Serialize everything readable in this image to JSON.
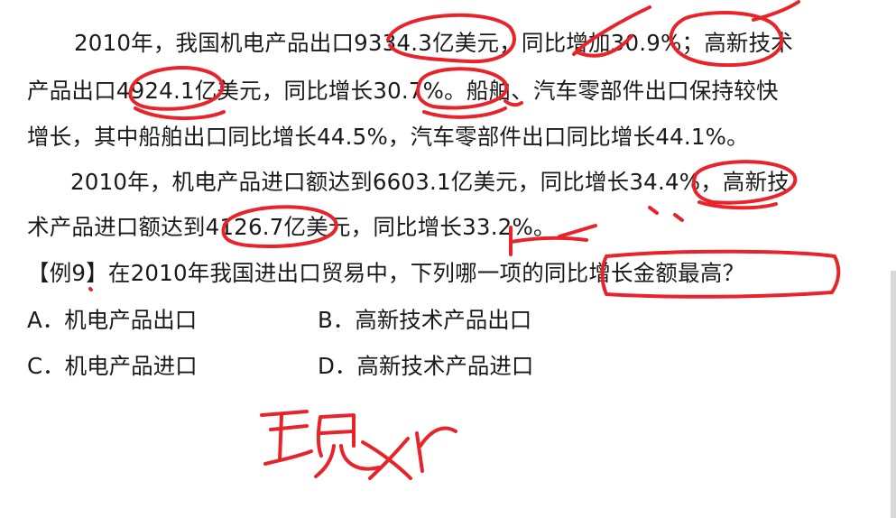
{
  "passage": {
    "line1": "2010年，我国机电产品出口9334.3亿美元，同比增加30.9%；高新技术",
    "line2": "产品出口4924.1亿美元，同比增长30.7%。船舶、汽车零部件出口保持较快",
    "line3": "增长，其中船舶出口同比增长44.5%，汽车零部件出口同比增长44.1%。",
    "line4": "2010年，机电产品进口额达到6603.1亿美元，同比增长34.4%，高新技",
    "line5": "术产品进口额达到4126.7亿美元，同比增长33.2%。"
  },
  "question": {
    "stem": "【例9】在2010年我国进出口贸易中，下列哪一项的同比增长金额最高？",
    "options": [
      {
        "letter": "A",
        "text": "A．机电产品出口"
      },
      {
        "letter": "B",
        "text": "B．高新技术产品出口"
      },
      {
        "letter": "C",
        "text": "C．机电产品进口"
      },
      {
        "letter": "D",
        "text": "D．高新技术产品进口"
      }
    ]
  },
  "handwriting": {
    "note": "现xr",
    "ink_color": "#e8242a"
  }
}
